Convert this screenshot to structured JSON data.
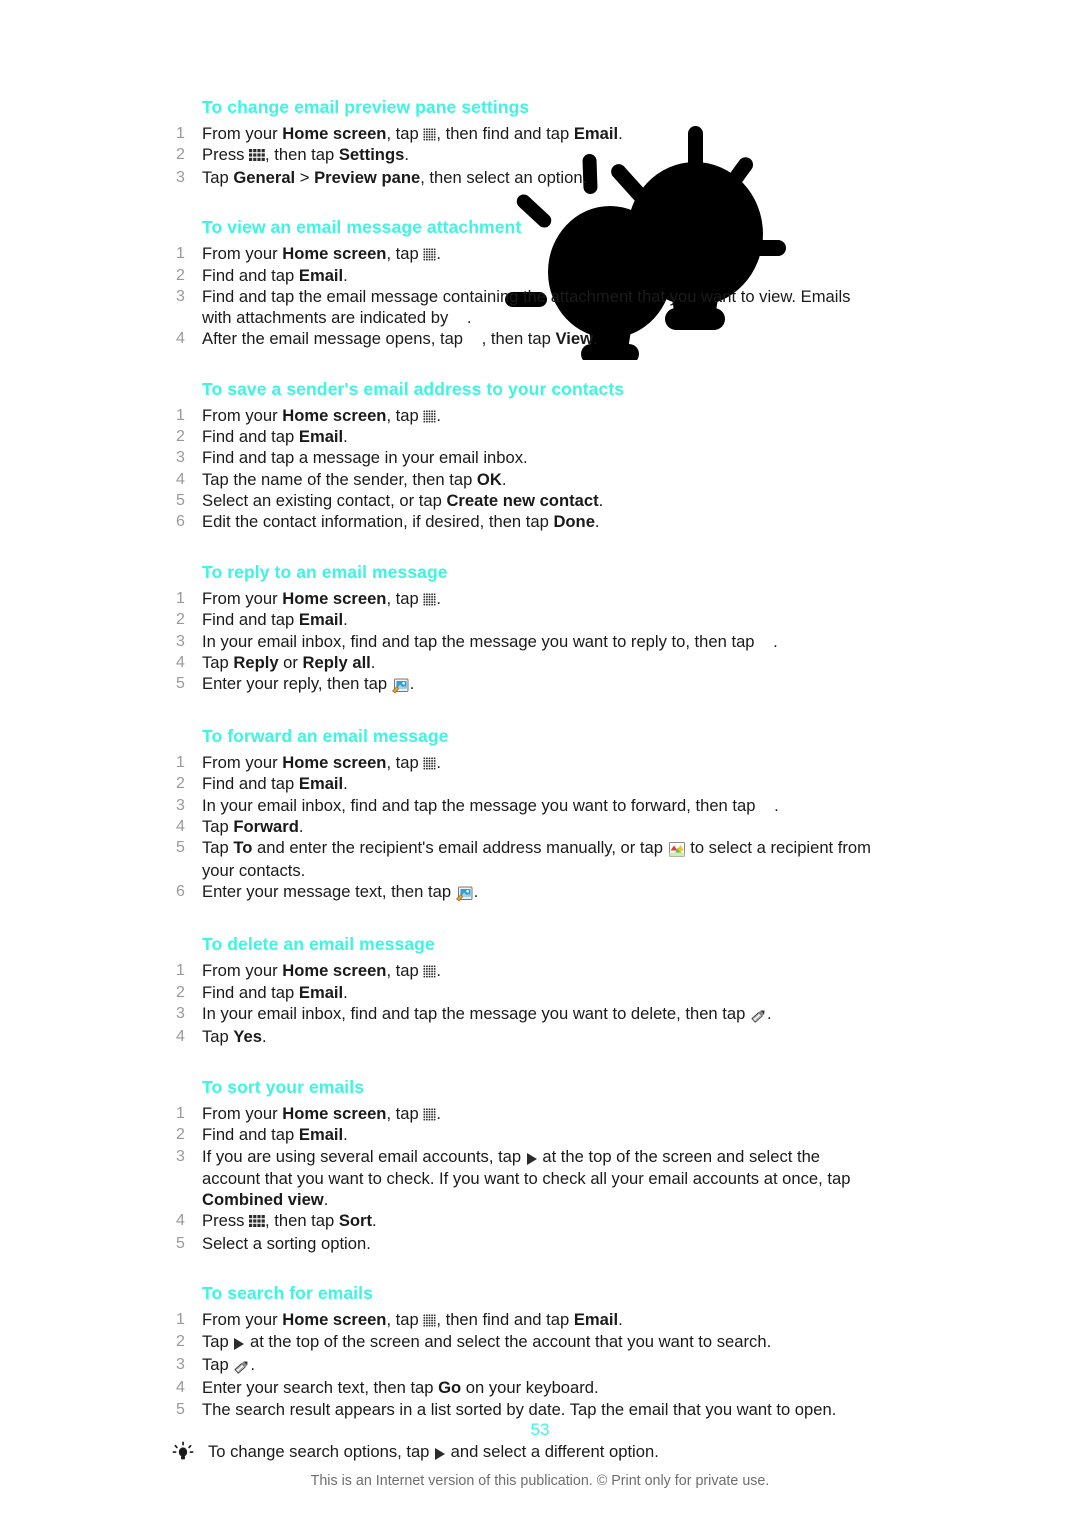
{
  "page": {
    "number": "53",
    "footer_note": "This is an Internet version of this publication. © Print only for private use."
  },
  "sections": [
    {
      "heading": "To change email preview pane settings",
      "steps": [
        {
          "parts": [
            {
              "t": "text",
              "v": "From your "
            },
            {
              "t": "bold",
              "v": "Home screen"
            },
            {
              "t": "text",
              "v": ", tap "
            },
            {
              "t": "icon",
              "v": "app-grid-icon"
            },
            {
              "t": "text",
              "v": ", then find and tap "
            },
            {
              "t": "bold",
              "v": "Email"
            },
            {
              "t": "text",
              "v": "."
            }
          ]
        },
        {
          "parts": [
            {
              "t": "text",
              "v": "Press "
            },
            {
              "t": "icon",
              "v": "menu-key-icon"
            },
            {
              "t": "text",
              "v": ", then tap "
            },
            {
              "t": "bold",
              "v": "Settings"
            },
            {
              "t": "text",
              "v": "."
            }
          ]
        },
        {
          "parts": [
            {
              "t": "text",
              "v": "Tap "
            },
            {
              "t": "bold",
              "v": "General"
            },
            {
              "t": "text",
              "v": " > "
            },
            {
              "t": "bold",
              "v": "Preview pane"
            },
            {
              "t": "text",
              "v": ", then select an option."
            }
          ]
        }
      ]
    },
    {
      "heading": "To view an email message attachment",
      "steps": [
        {
          "parts": [
            {
              "t": "text",
              "v": "From your "
            },
            {
              "t": "bold",
              "v": "Home screen"
            },
            {
              "t": "text",
              "v": ", tap "
            },
            {
              "t": "icon",
              "v": "app-grid-icon"
            },
            {
              "t": "text",
              "v": "."
            }
          ]
        },
        {
          "parts": [
            {
              "t": "text",
              "v": "Find and tap "
            },
            {
              "t": "bold",
              "v": "Email"
            },
            {
              "t": "text",
              "v": "."
            }
          ]
        },
        {
          "parts": [
            {
              "t": "text",
              "v": "Find and tap the email message containing the attachment that you want to view. Emails with attachments are indicated by "
            },
            {
              "t": "icon",
              "v": "attachment-icon"
            },
            {
              "t": "text",
              "v": "."
            }
          ]
        },
        {
          "parts": [
            {
              "t": "text",
              "v": "After the email message opens, tap "
            },
            {
              "t": "icon",
              "v": "attachment-icon"
            },
            {
              "t": "text",
              "v": ", then tap "
            },
            {
              "t": "bold",
              "v": "View"
            },
            {
              "t": "text",
              "v": "."
            }
          ]
        }
      ]
    },
    {
      "heading": "To save a sender's email address to your contacts",
      "steps": [
        {
          "parts": [
            {
              "t": "text",
              "v": "From your "
            },
            {
              "t": "bold",
              "v": "Home screen"
            },
            {
              "t": "text",
              "v": ", tap "
            },
            {
              "t": "icon",
              "v": "app-grid-icon"
            },
            {
              "t": "text",
              "v": "."
            }
          ]
        },
        {
          "parts": [
            {
              "t": "text",
              "v": "Find and tap "
            },
            {
              "t": "bold",
              "v": "Email"
            },
            {
              "t": "text",
              "v": "."
            }
          ]
        },
        {
          "parts": [
            {
              "t": "text",
              "v": "Find and tap a message in your email inbox."
            }
          ]
        },
        {
          "parts": [
            {
              "t": "text",
              "v": "Tap the name of the sender, then tap "
            },
            {
              "t": "bold",
              "v": "OK"
            },
            {
              "t": "text",
              "v": "."
            }
          ]
        },
        {
          "parts": [
            {
              "t": "text",
              "v": "Select an existing contact, or tap "
            },
            {
              "t": "bold",
              "v": "Create new contact"
            },
            {
              "t": "text",
              "v": "."
            }
          ]
        },
        {
          "parts": [
            {
              "t": "text",
              "v": "Edit the contact information, if desired, then tap "
            },
            {
              "t": "bold",
              "v": "Done"
            },
            {
              "t": "text",
              "v": "."
            }
          ]
        }
      ]
    },
    {
      "heading": "To reply to an email message",
      "steps": [
        {
          "parts": [
            {
              "t": "text",
              "v": "From your "
            },
            {
              "t": "bold",
              "v": "Home screen"
            },
            {
              "t": "text",
              "v": ", tap "
            },
            {
              "t": "icon",
              "v": "app-grid-icon"
            },
            {
              "t": "text",
              "v": "."
            }
          ]
        },
        {
          "parts": [
            {
              "t": "text",
              "v": "Find and tap "
            },
            {
              "t": "bold",
              "v": "Email"
            },
            {
              "t": "text",
              "v": "."
            }
          ]
        },
        {
          "parts": [
            {
              "t": "text",
              "v": "In your email inbox, find and tap the message you want to reply to, then tap "
            },
            {
              "t": "icon",
              "v": "reply-icon"
            },
            {
              "t": "text",
              "v": "."
            }
          ]
        },
        {
          "parts": [
            {
              "t": "text",
              "v": "Tap "
            },
            {
              "t": "bold",
              "v": "Reply"
            },
            {
              "t": "text",
              "v": " or "
            },
            {
              "t": "bold",
              "v": "Reply all"
            },
            {
              "t": "text",
              "v": "."
            }
          ]
        },
        {
          "parts": [
            {
              "t": "text",
              "v": "Enter your reply, then tap "
            },
            {
              "t": "icon",
              "v": "send-icon"
            },
            {
              "t": "text",
              "v": "."
            }
          ]
        }
      ]
    },
    {
      "heading": "To forward an email message",
      "steps": [
        {
          "parts": [
            {
              "t": "text",
              "v": "From your "
            },
            {
              "t": "bold",
              "v": "Home screen"
            },
            {
              "t": "text",
              "v": ", tap "
            },
            {
              "t": "icon",
              "v": "app-grid-icon"
            },
            {
              "t": "text",
              "v": "."
            }
          ]
        },
        {
          "parts": [
            {
              "t": "text",
              "v": "Find and tap "
            },
            {
              "t": "bold",
              "v": "Email"
            },
            {
              "t": "text",
              "v": "."
            }
          ]
        },
        {
          "parts": [
            {
              "t": "text",
              "v": "In your email inbox, find and tap the message you want to forward, then tap "
            },
            {
              "t": "icon",
              "v": "forward-icon"
            },
            {
              "t": "text",
              "v": "."
            }
          ]
        },
        {
          "parts": [
            {
              "t": "text",
              "v": "Tap "
            },
            {
              "t": "bold",
              "v": "Forward"
            },
            {
              "t": "text",
              "v": "."
            }
          ]
        },
        {
          "parts": [
            {
              "t": "text",
              "v": "Tap "
            },
            {
              "t": "bold",
              "v": "To"
            },
            {
              "t": "text",
              "v": " and enter the recipient's email address manually, or tap "
            },
            {
              "t": "icon",
              "v": "contacts-icon"
            },
            {
              "t": "text",
              "v": " to select a recipient from your contacts."
            }
          ]
        },
        {
          "parts": [
            {
              "t": "text",
              "v": "Enter your message text, then tap "
            },
            {
              "t": "icon",
              "v": "send-icon"
            },
            {
              "t": "text",
              "v": "."
            }
          ]
        }
      ]
    },
    {
      "heading": "To delete an email message",
      "steps": [
        {
          "parts": [
            {
              "t": "text",
              "v": "From your "
            },
            {
              "t": "bold",
              "v": "Home screen"
            },
            {
              "t": "text",
              "v": ", tap "
            },
            {
              "t": "icon",
              "v": "app-grid-icon"
            },
            {
              "t": "text",
              "v": "."
            }
          ]
        },
        {
          "parts": [
            {
              "t": "text",
              "v": "Find and tap "
            },
            {
              "t": "bold",
              "v": "Email"
            },
            {
              "t": "text",
              "v": "."
            }
          ]
        },
        {
          "parts": [
            {
              "t": "text",
              "v": "In your email inbox, find and tap the message you want to delete, then tap "
            },
            {
              "t": "icon",
              "v": "pencil-icon"
            },
            {
              "t": "text",
              "v": "."
            }
          ]
        },
        {
          "parts": [
            {
              "t": "text",
              "v": "Tap "
            },
            {
              "t": "bold",
              "v": "Yes"
            },
            {
              "t": "text",
              "v": "."
            }
          ]
        }
      ]
    },
    {
      "heading": "To sort your emails",
      "steps": [
        {
          "parts": [
            {
              "t": "text",
              "v": "From your "
            },
            {
              "t": "bold",
              "v": "Home screen"
            },
            {
              "t": "text",
              "v": ", tap "
            },
            {
              "t": "icon",
              "v": "app-grid-icon"
            },
            {
              "t": "text",
              "v": "."
            }
          ]
        },
        {
          "parts": [
            {
              "t": "text",
              "v": "Find and tap "
            },
            {
              "t": "bold",
              "v": "Email"
            },
            {
              "t": "text",
              "v": "."
            }
          ]
        },
        {
          "parts": [
            {
              "t": "text",
              "v": "If you are using several email accounts, tap "
            },
            {
              "t": "icon",
              "v": "play-arrow-icon"
            },
            {
              "t": "text",
              "v": " at the top of the screen and select the account that you want to check. If you want to check all your email accounts at once, tap "
            },
            {
              "t": "bold",
              "v": "Combined view"
            },
            {
              "t": "text",
              "v": "."
            }
          ]
        },
        {
          "parts": [
            {
              "t": "text",
              "v": "Press "
            },
            {
              "t": "icon",
              "v": "menu-key-icon"
            },
            {
              "t": "text",
              "v": ", then tap "
            },
            {
              "t": "bold",
              "v": "Sort"
            },
            {
              "t": "text",
              "v": "."
            }
          ]
        },
        {
          "parts": [
            {
              "t": "text",
              "v": "Select a sorting option."
            }
          ]
        }
      ]
    },
    {
      "heading": "To search for emails",
      "steps": [
        {
          "parts": [
            {
              "t": "text",
              "v": "From your "
            },
            {
              "t": "bold",
              "v": "Home screen"
            },
            {
              "t": "text",
              "v": ", tap "
            },
            {
              "t": "icon",
              "v": "app-grid-icon"
            },
            {
              "t": "text",
              "v": ", then find and tap "
            },
            {
              "t": "bold",
              "v": "Email"
            },
            {
              "t": "text",
              "v": "."
            }
          ]
        },
        {
          "parts": [
            {
              "t": "text",
              "v": "Tap "
            },
            {
              "t": "icon",
              "v": "play-arrow-icon"
            },
            {
              "t": "text",
              "v": " at the top of the screen and select the account that you want to search."
            }
          ]
        },
        {
          "parts": [
            {
              "t": "text",
              "v": "Tap "
            },
            {
              "t": "icon",
              "v": "pencil-icon"
            },
            {
              "t": "text",
              "v": "."
            }
          ]
        },
        {
          "parts": [
            {
              "t": "text",
              "v": "Enter your search text, then tap "
            },
            {
              "t": "bold",
              "v": "Go"
            },
            {
              "t": "text",
              "v": " on your keyboard."
            }
          ]
        },
        {
          "parts": [
            {
              "t": "text",
              "v": "The search result appears in a list sorted by date. Tap the email that you want to open."
            }
          ]
        }
      ],
      "tip": {
        "icon": "tip-bulb-icon",
        "parts": [
          {
            "t": "text",
            "v": "To change search options, tap "
          },
          {
            "t": "icon",
            "v": "play-arrow-icon"
          },
          {
            "t": "text",
            "v": " and select a different option."
          }
        ]
      }
    }
  ],
  "decoration": {
    "name": "lightbulb-artwork",
    "color": "#000000"
  },
  "colors": {
    "heading": "#3df5e0",
    "step_number": "#9a9a9a",
    "body": "#1a1a1a",
    "footer": "#6e6e6e"
  }
}
